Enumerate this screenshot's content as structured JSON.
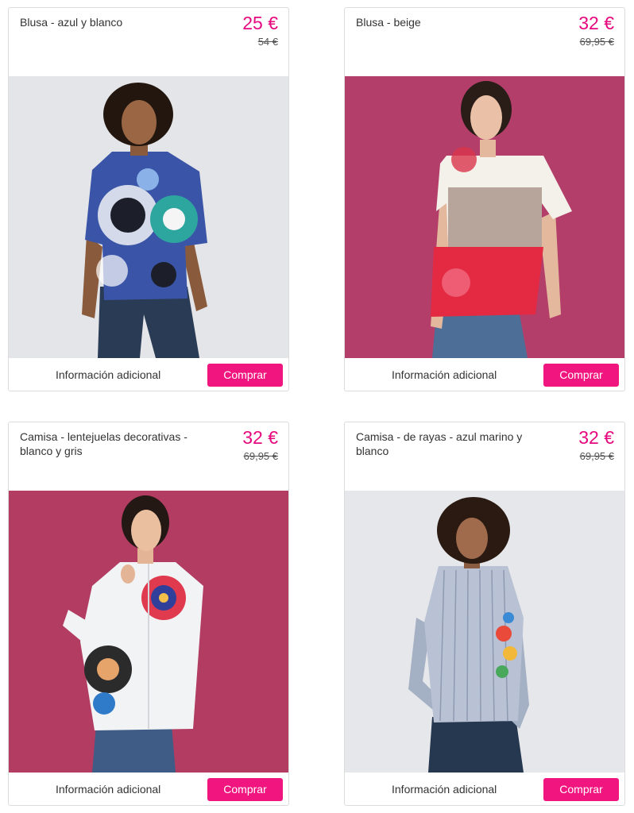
{
  "colors": {
    "accent": "#e5087e",
    "button": "#f0157f"
  },
  "products": [
    {
      "title": "Blusa - azul y blanco",
      "price": "25 €",
      "old_price": "54 €",
      "info_label": "Información adicional",
      "buy_label": "Comprar",
      "image": "woman-blue-patterned-blouse"
    },
    {
      "title": "Blusa - beige",
      "price": "32 €",
      "old_price": "69,95 €",
      "info_label": "Información adicional",
      "buy_label": "Comprar",
      "image": "woman-beige-red-blouse"
    },
    {
      "title": "Camisa - lentejuelas decorativas - blanco y gris",
      "price": "32 €",
      "old_price": "69,95 €",
      "info_label": "Información adicional",
      "buy_label": "Comprar",
      "image": "woman-white-sequin-shirt"
    },
    {
      "title": "Camisa - de rayas - azul marino y blanco",
      "price": "32 €",
      "old_price": "69,95 €",
      "info_label": "Información adicional",
      "buy_label": "Comprar",
      "image": "woman-striped-shirt"
    }
  ]
}
